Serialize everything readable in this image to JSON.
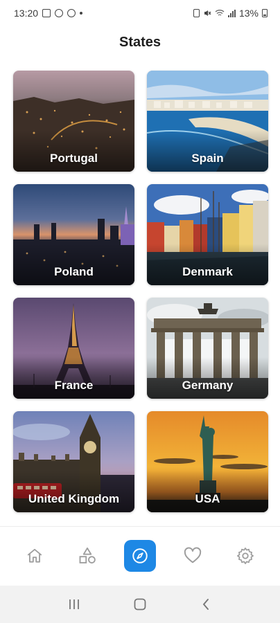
{
  "status_bar": {
    "time": "13:20",
    "battery_text": "13%",
    "icons": [
      "photo-icon",
      "cast-icon",
      "sync-icon",
      "dot-icon",
      "battery-saver-icon",
      "mute-icon",
      "wifi-icon",
      "signal-icon",
      "battery-icon"
    ]
  },
  "header": {
    "title": "States"
  },
  "states": [
    {
      "label": "Portugal"
    },
    {
      "label": "Spain"
    },
    {
      "label": "Poland"
    },
    {
      "label": "Denmark"
    },
    {
      "label": "France"
    },
    {
      "label": "Germany"
    },
    {
      "label": "United Kingdom"
    },
    {
      "label": "USA"
    }
  ],
  "bottom_nav": {
    "items": [
      "home-icon",
      "categories-icon",
      "explore-icon",
      "favorites-icon",
      "settings-icon"
    ],
    "active": "explore-icon",
    "accent_color": "#1e88e5",
    "inactive_color": "#9e9e9e"
  },
  "system_nav": {
    "items": [
      "recent-apps-icon",
      "home-button-icon",
      "back-icon"
    ]
  }
}
